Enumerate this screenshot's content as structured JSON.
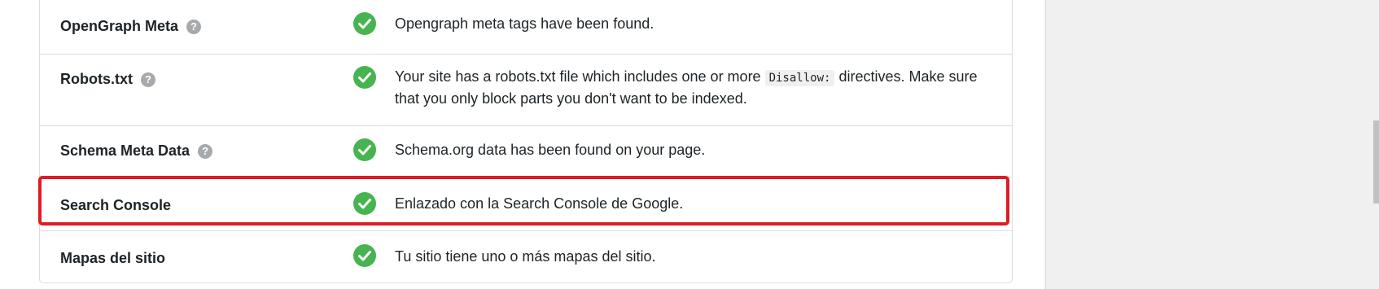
{
  "colors": {
    "success": "#46b450",
    "highlight": "#e01b24",
    "border": "#dcdcde"
  },
  "rows": [
    {
      "label": "OpenGraph Meta",
      "has_help": true,
      "status_icon": "check-circle-icon",
      "description": "Opengraph meta tags have been found."
    },
    {
      "label": "Robots.txt",
      "has_help": true,
      "status_icon": "check-circle-icon",
      "description_part1": "Your site has a robots.txt file which includes one or more ",
      "description_code": "Disallow:",
      "description_part2": " directives. Make sure that you only block parts you don't want to be indexed."
    },
    {
      "label": "Schema Meta Data",
      "has_help": true,
      "status_icon": "check-circle-icon",
      "description": "Schema.org data has been found on your page."
    },
    {
      "label": "Search Console",
      "has_help": false,
      "status_icon": "check-circle-icon",
      "highlighted": true,
      "description": "Enlazado con la Search Console de Google."
    },
    {
      "label": "Mapas del sitio",
      "has_help": false,
      "status_icon": "check-circle-icon",
      "description": "Tu sitio tiene uno o más mapas del sitio."
    }
  ],
  "help_glyph": "?"
}
